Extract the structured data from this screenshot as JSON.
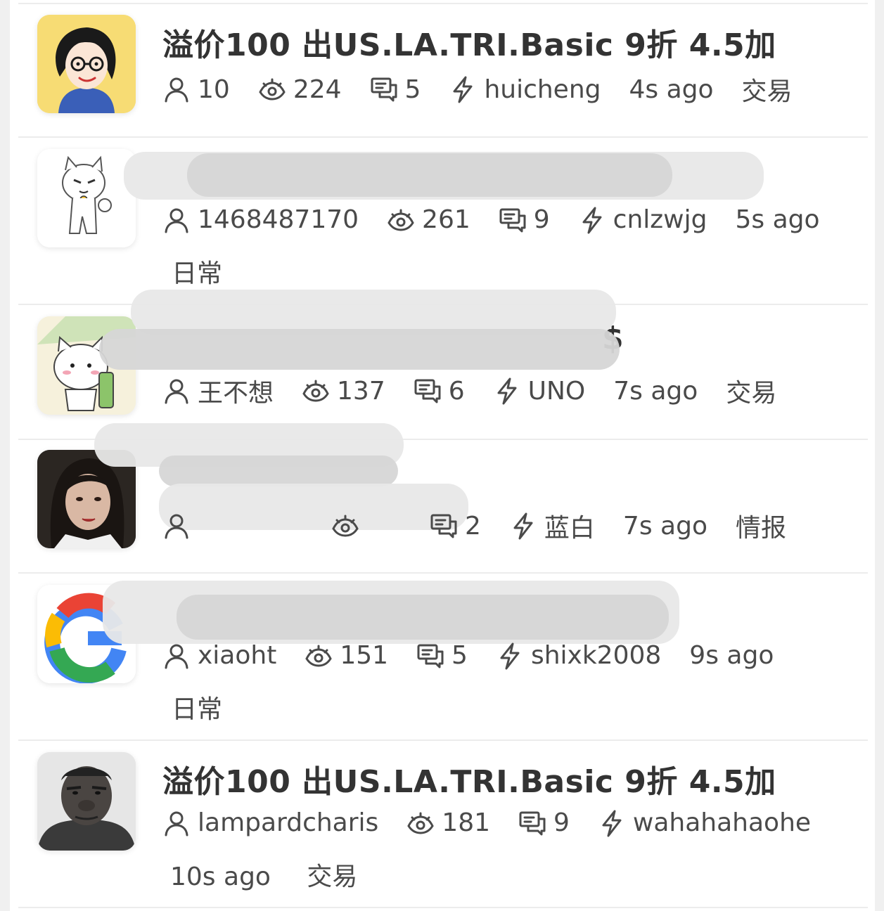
{
  "posts": [
    {
      "title": "溢价100 出US.LA.TRI.Basic 9折 4.5加",
      "author": "10",
      "views": "224",
      "replies": "5",
      "last_reply_user": "huicheng",
      "time": "4s ago",
      "category": "交易"
    },
    {
      "title": "",
      "author": "1468487170",
      "views": "261",
      "replies": "9",
      "last_reply_user": "cnlzwjg",
      "time": "5s ago",
      "category": "日常"
    },
    {
      "title": "$",
      "author": "王不想",
      "views": "137",
      "replies": "6",
      "last_reply_user": "UNO",
      "time": "7s ago",
      "category": "交易"
    },
    {
      "title": "",
      "author": "",
      "views": "",
      "replies": "2",
      "last_reply_user": "蓝白",
      "time": "7s ago",
      "category": "情报"
    },
    {
      "title": "",
      "author": "xiaoht",
      "views": "151",
      "replies": "5",
      "last_reply_user": "shixk2008",
      "time": "9s ago",
      "category": "日常"
    },
    {
      "title": "溢价100 出US.LA.TRI.Basic 9折 4.5加",
      "author": "lampardcharis",
      "views": "181",
      "replies": "9",
      "last_reply_user": "wahahahaohe",
      "time": "10s ago",
      "category": "交易"
    }
  ],
  "colors": {
    "background": "#f0f0f0",
    "card": "#ffffff",
    "divider": "#ececec",
    "text": "#333333"
  },
  "icons": [
    "user-icon",
    "eye-icon",
    "reply-icon",
    "bolt-icon"
  ]
}
